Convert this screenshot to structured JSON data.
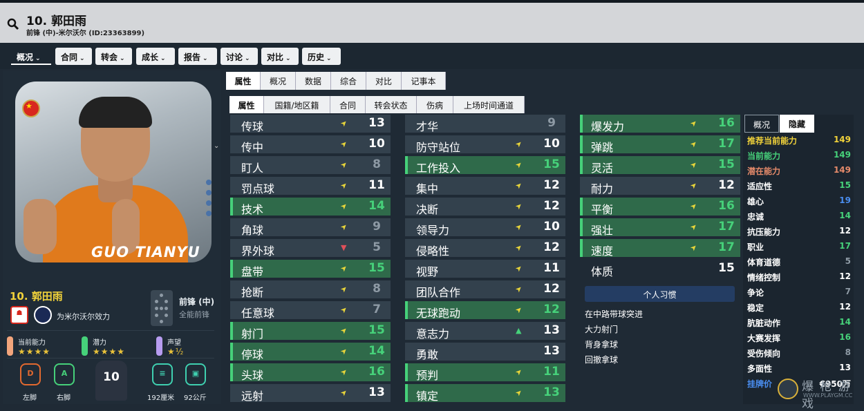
{
  "header": {
    "title": "10. 郭田雨",
    "subtitle": "前锋 (中)-米尔沃尔 (ID:23363899)"
  },
  "menu": [
    {
      "label": "概况"
    },
    {
      "label": "合同"
    },
    {
      "label": "转会"
    },
    {
      "label": "成长"
    },
    {
      "label": "报告"
    },
    {
      "label": "讨论"
    },
    {
      "label": "对比"
    },
    {
      "label": "历史"
    }
  ],
  "tabs_primary": [
    "属性",
    "概况",
    "数据",
    "综合",
    "对比",
    "记事本"
  ],
  "tabs_secondary": [
    "属性",
    "国籍/地区籍",
    "合同",
    "转会状态",
    "伤病",
    "上场时间通道"
  ],
  "player": {
    "portrait_name": "GUO TIANYU",
    "name": "10. 郭田雨",
    "club": "为米尔沃尔效力",
    "position_main": "前锋 (中)",
    "position_sub": "全能前锋",
    "current_ability_label": "当前能力",
    "potential_label": "潜力",
    "reputation_label": "声望",
    "current_stars": "★★★★",
    "potential_stars": "★★★★",
    "reputation_stars": "★½",
    "left_foot_grade": "D",
    "right_foot_grade": "A",
    "left_foot_label": "左脚",
    "right_foot_label": "右脚",
    "shirt_number": "10",
    "height": "192厘米",
    "weight": "92公斤"
  },
  "technical": [
    {
      "name": "传球",
      "value": "13",
      "arrow": "➤",
      "hl": false
    },
    {
      "name": "传中",
      "value": "10",
      "arrow": "➤",
      "hl": false
    },
    {
      "name": "盯人",
      "value": "8",
      "arrow": "➤",
      "hl": false
    },
    {
      "name": "罚点球",
      "value": "11",
      "arrow": "➤",
      "hl": false
    },
    {
      "name": "技术",
      "value": "14",
      "arrow": "➤",
      "hl": true
    },
    {
      "name": "角球",
      "value": "9",
      "arrow": "➤",
      "hl": false
    },
    {
      "name": "界外球",
      "value": "5",
      "arrow": "▼",
      "hl": false
    },
    {
      "name": "盘带",
      "value": "15",
      "arrow": "➤",
      "hl": true
    },
    {
      "name": "抢断",
      "value": "8",
      "arrow": "➤",
      "hl": false
    },
    {
      "name": "任意球",
      "value": "7",
      "arrow": "➤",
      "hl": false
    },
    {
      "name": "射门",
      "value": "15",
      "arrow": "➤",
      "hl": true
    },
    {
      "name": "停球",
      "value": "14",
      "arrow": "➤",
      "hl": true
    },
    {
      "name": "头球",
      "value": "16",
      "arrow": "➤",
      "hl": true
    },
    {
      "name": "远射",
      "value": "13",
      "arrow": "➤",
      "hl": false
    }
  ],
  "mental": [
    {
      "name": "才华",
      "value": "9",
      "arrow": "",
      "hl": false
    },
    {
      "name": "防守站位",
      "value": "10",
      "arrow": "➤",
      "hl": false
    },
    {
      "name": "工作投入",
      "value": "15",
      "arrow": "➤",
      "hl": true
    },
    {
      "name": "集中",
      "value": "12",
      "arrow": "➤",
      "hl": false
    },
    {
      "name": "决断",
      "value": "12",
      "arrow": "➤",
      "hl": false
    },
    {
      "name": "领导力",
      "value": "10",
      "arrow": "➤",
      "hl": false
    },
    {
      "name": "侵略性",
      "value": "12",
      "arrow": "➤",
      "hl": false
    },
    {
      "name": "视野",
      "value": "11",
      "arrow": "➤",
      "hl": false
    },
    {
      "name": "团队合作",
      "value": "12",
      "arrow": "➤",
      "hl": false
    },
    {
      "name": "无球跑动",
      "value": "12",
      "arrow": "➤",
      "hl": true
    },
    {
      "name": "意志力",
      "value": "13",
      "arrow": "▲",
      "hl": false
    },
    {
      "name": "勇敢",
      "value": "13",
      "arrow": "",
      "hl": false
    },
    {
      "name": "预判",
      "value": "11",
      "arrow": "➤",
      "hl": true
    },
    {
      "name": "镇定",
      "value": "13",
      "arrow": "➤",
      "hl": true
    }
  ],
  "physical": [
    {
      "name": "爆发力",
      "value": "16",
      "arrow": "➤",
      "hl": true
    },
    {
      "name": "弹跳",
      "value": "17",
      "arrow": "➤",
      "hl": true
    },
    {
      "name": "灵活",
      "value": "15",
      "arrow": "➤",
      "hl": true
    },
    {
      "name": "耐力",
      "value": "12",
      "arrow": "➤",
      "hl": false
    },
    {
      "name": "平衡",
      "value": "16",
      "arrow": "➤",
      "hl": true
    },
    {
      "name": "强壮",
      "value": "17",
      "arrow": "➤",
      "hl": true
    },
    {
      "name": "速度",
      "value": "17",
      "arrow": "➤",
      "hl": true
    },
    {
      "name": "体质",
      "value": "15",
      "arrow": "",
      "hl": false
    }
  ],
  "habits": {
    "title": "个人习惯",
    "items": [
      "在中路带球突进",
      "大力射门",
      "背身拿球",
      "回撤拿球"
    ]
  },
  "hidden_panel": {
    "tabs": [
      "概况",
      "隐藏"
    ],
    "rows": [
      {
        "key": "推荐当前能力",
        "value": "149",
        "kcolor": "#f1d23a",
        "vcolor": "#f1d23a"
      },
      {
        "key": "当前能力",
        "value": "149",
        "kcolor": "#46d17a",
        "vcolor": "#46d17a"
      },
      {
        "key": "潜在能力",
        "value": "149",
        "kcolor": "#e58a6a",
        "vcolor": "#e58a6a"
      },
      {
        "key": "适应性",
        "value": "15",
        "kcolor": "#ffffff",
        "vcolor": "#46d17a"
      },
      {
        "key": "雄心",
        "value": "19",
        "kcolor": "#ffffff",
        "vcolor": "#4a8ef0"
      },
      {
        "key": "忠诚",
        "value": "14",
        "kcolor": "#ffffff",
        "vcolor": "#46d17a"
      },
      {
        "key": "抗压能力",
        "value": "12",
        "kcolor": "#ffffff",
        "vcolor": "#ffffff"
      },
      {
        "key": "职业",
        "value": "17",
        "kcolor": "#ffffff",
        "vcolor": "#46d17a"
      },
      {
        "key": "体育道德",
        "value": "5",
        "kcolor": "#ffffff",
        "vcolor": "#8e9aa5"
      },
      {
        "key": "情绪控制",
        "value": "12",
        "kcolor": "#ffffff",
        "vcolor": "#ffffff"
      },
      {
        "key": "争论",
        "value": "7",
        "kcolor": "#ffffff",
        "vcolor": "#8e9aa5"
      },
      {
        "key": "稳定",
        "value": "12",
        "kcolor": "#ffffff",
        "vcolor": "#ffffff"
      },
      {
        "key": "肮脏动作",
        "value": "14",
        "kcolor": "#ffffff",
        "vcolor": "#46d17a"
      },
      {
        "key": "大赛发挥",
        "value": "16",
        "kcolor": "#ffffff",
        "vcolor": "#46d17a"
      },
      {
        "key": "受伤倾向",
        "value": "8",
        "kcolor": "#ffffff",
        "vcolor": "#8e9aa5"
      },
      {
        "key": "多面性",
        "value": "13",
        "kcolor": "#ffffff",
        "vcolor": "#ffffff"
      },
      {
        "key": "挂牌价",
        "value": "€950万",
        "kcolor": "#4a8ef0",
        "vcolor": "#ffffff"
      }
    ]
  },
  "watermark": {
    "main": "爆 枪 游 戏",
    "url": "WWW.PLAYGM.CC"
  },
  "colors": {
    "green": "#46d17a",
    "yellow": "#f1d23a",
    "arrow": "#e9d63a"
  }
}
